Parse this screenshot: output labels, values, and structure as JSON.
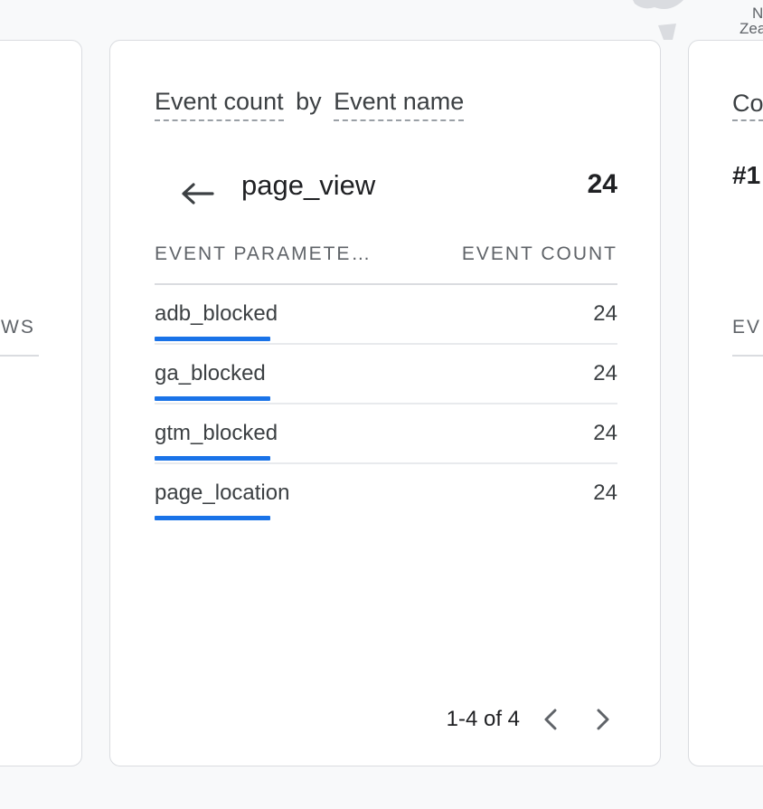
{
  "map": {
    "label_lines": [
      "N",
      "Zea"
    ]
  },
  "left_card": {
    "column_header_fragment": "WS"
  },
  "main_card": {
    "title_metric": "Event count",
    "title_connector": "by",
    "title_dimension": "Event name",
    "back_icon": "arrow-left-icon",
    "selected_event": "page_view",
    "selected_event_count": "24",
    "table": {
      "headers": {
        "parameter": "EVENT PARAMETE…",
        "count": "EVENT COUNT"
      },
      "rows": [
        {
          "name": "adb_blocked",
          "count": "24",
          "share": 1.0
        },
        {
          "name": "ga_blocked",
          "count": "24",
          "share": 1.0
        },
        {
          "name": "gtm_blocked",
          "count": "24",
          "share": 1.0
        },
        {
          "name": "page_location",
          "count": "24",
          "share": 1.0
        }
      ],
      "bar_color": "#1a73e8"
    },
    "pagination": {
      "label": "1-4 of 4",
      "prev_icon": "chevron-left-icon",
      "next_icon": "chevron-right-icon"
    }
  },
  "right_card": {
    "title_fragment": "Co",
    "rank_fragment": "#1",
    "column_header_fragment": "EV"
  }
}
